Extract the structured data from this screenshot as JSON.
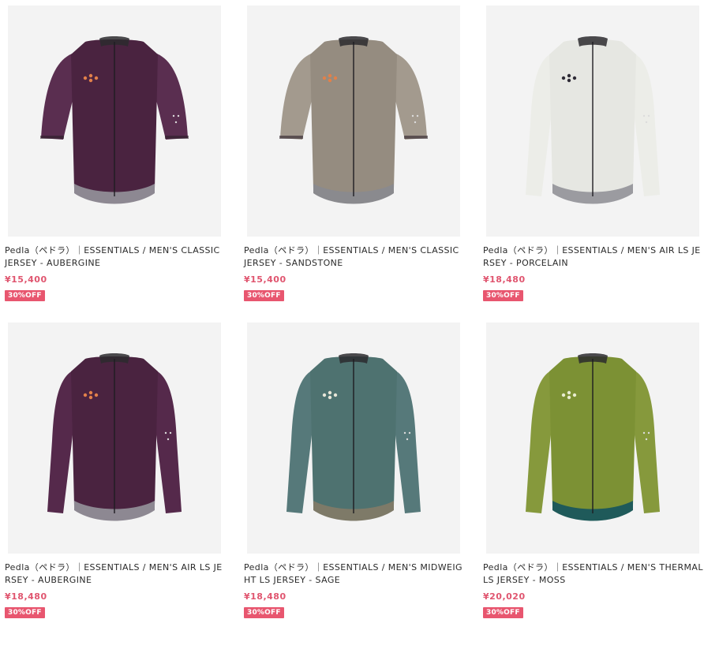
{
  "products": [
    {
      "title": "Pedla（ペドラ）｜ESSENTIALS / MEN'S CLASSIC JERSEY - AUBERGINE",
      "price": "¥15,400",
      "badge": "30%OFF",
      "body_color": "#4a2340",
      "sleeve_color": "#5a2e50",
      "logo_color": "#e2804a",
      "hem_color": "#8d8892",
      "sleeve_style": "short"
    },
    {
      "title": "Pedla（ペドラ）｜ESSENTIALS / MEN'S CLASSIC JERSEY - SANDSTONE",
      "price": "¥15,400",
      "badge": "30%OFF",
      "body_color": "#958c80",
      "sleeve_color": "#a39a8e",
      "logo_color": "#e2804a",
      "hem_color": "#8a8a8e",
      "sleeve_style": "short"
    },
    {
      "title": "Pedla（ペドラ）｜ESSENTIALS / MEN'S AIR LS JERSEY - PORCELAIN",
      "price": "¥18,480",
      "badge": "30%OFF",
      "body_color": "#e6e7e2",
      "sleeve_color": "#ecede8",
      "logo_color": "#2e2b36",
      "hem_color": "#9b9ba0",
      "sleeve_style": "long"
    },
    {
      "title": "Pedla（ペドラ）｜ESSENTIALS / MEN'S AIR LS JERSEY - AUBERGINE",
      "price": "¥18,480",
      "badge": "30%OFF",
      "body_color": "#4a2340",
      "sleeve_color": "#55294b",
      "logo_color": "#e2804a",
      "hem_color": "#8d8892",
      "sleeve_style": "long"
    },
    {
      "title": "Pedla（ペドラ）｜ESSENTIALS / MEN'S MIDWEIGHT LS JERSEY - SAGE",
      "price": "¥18,480",
      "badge": "30%OFF",
      "body_color": "#4e7270",
      "sleeve_color": "#56797a",
      "logo_color": "#e8e6d8",
      "hem_color": "#7e7a68",
      "sleeve_style": "long"
    },
    {
      "title": "Pedla（ペドラ）｜ESSENTIALS / MEN'S THERMAL LS JERSEY - MOSS",
      "price": "¥20,020",
      "badge": "30%OFF",
      "body_color": "#7c9134",
      "sleeve_color": "#86993c",
      "logo_color": "#e8ecd0",
      "hem_color": "#1f5a5a",
      "sleeve_style": "long"
    }
  ]
}
